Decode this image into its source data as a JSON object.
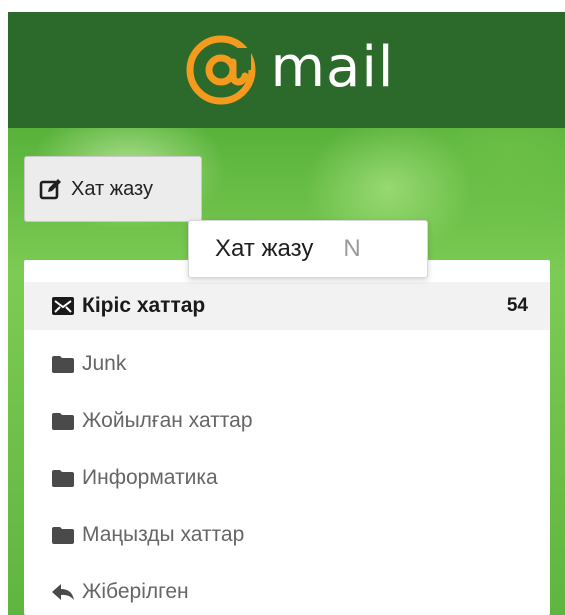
{
  "header": {
    "logo_text": "mail",
    "logo_icon": "at-sign-logo",
    "brand_color": "#f39a1f",
    "header_bg": "#2b6a2a"
  },
  "compose": {
    "label": "Хат жазу",
    "icon": "edit-icon"
  },
  "tooltip": {
    "text": "Хат жазу",
    "shortcut": "N"
  },
  "folders": [
    {
      "label": "Кіріс хаттар",
      "count": "54",
      "icon": "inbox-icon",
      "selected": true
    },
    {
      "label": "Junk",
      "count": "",
      "icon": "folder-icon",
      "selected": false
    },
    {
      "label": "Жойылған хаттар",
      "count": "",
      "icon": "folder-icon",
      "selected": false
    },
    {
      "label": "Информатика",
      "count": "",
      "icon": "folder-icon",
      "selected": false
    },
    {
      "label": "Маңызды хаттар",
      "count": "",
      "icon": "folder-icon",
      "selected": false
    },
    {
      "label": "Жіберілген",
      "count": "",
      "icon": "reply-icon",
      "selected": false
    }
  ]
}
